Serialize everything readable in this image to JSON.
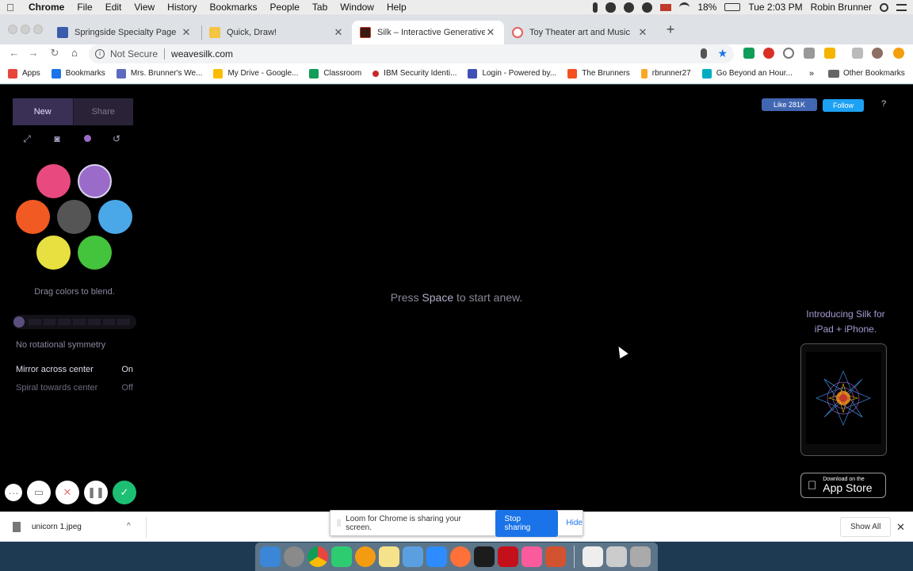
{
  "menubar": {
    "items": [
      "Chrome",
      "File",
      "Edit",
      "View",
      "History",
      "Bookmarks",
      "People",
      "Tab",
      "Window",
      "Help"
    ],
    "battery": "18%",
    "clock": "Tue 2:03 PM",
    "user": "Robin Brunner"
  },
  "tabs": [
    {
      "title": "Springside Specialty Page",
      "favicon_color": "#3b5bab"
    },
    {
      "title": "Quick, Draw!",
      "favicon_color": "#f4c542"
    },
    {
      "title": "Silk – Interactive Generative Art",
      "favicon_color": "#3a1a10"
    },
    {
      "title": "Toy Theater art and Music",
      "favicon_color": "#e46060"
    }
  ],
  "omnibox": {
    "security": "Not Secure",
    "url": "weavesilk.com"
  },
  "bookmarks": {
    "items": [
      {
        "label": "Apps",
        "color": "#e8453c"
      },
      {
        "label": "Bookmarks",
        "color": "#1a73e8"
      },
      {
        "label": "Mrs. Brunner's We...",
        "color": "#5c6bc0"
      },
      {
        "label": "My Drive - Google...",
        "color": "#fbbc04"
      },
      {
        "label": "Classroom",
        "color": "#0f9d58"
      },
      {
        "label": "IBM Security Identi...",
        "color": "#c62828"
      },
      {
        "label": "Login - Powered by...",
        "color": "#3f51b5"
      },
      {
        "label": "The Brunners",
        "color": "#f4511e"
      },
      {
        "label": "rbrunner27",
        "color": "#f9a825"
      },
      {
        "label": "Go Beyond an Hour...",
        "color": "#00acc1"
      }
    ],
    "more": "»",
    "other": "Other Bookmarks"
  },
  "silk": {
    "new_label": "New",
    "share_label": "Share",
    "drag_hint": "Drag colors to blend.",
    "symmetry_label": "No rotational symmetry",
    "mirror_label": "Mirror across center",
    "mirror_value": "On",
    "spiral_label": "Spiral towards center",
    "spiral_value": "Off",
    "press_space_pre": "Press ",
    "press_space_key": "Space",
    "press_space_post": " to start anew.",
    "fb_like": "Like 281K",
    "tw_follow": "Follow",
    "help": "?",
    "intro_line1": "Introducing Silk for",
    "intro_line2": "iPad + iPhone.",
    "appstore_small": "Download on the",
    "appstore_big": "App Store",
    "swatches": [
      "#e84a7f",
      "#9b6bc9",
      "#f15a22",
      "#555555",
      "#4aa8e8",
      "#e8e040",
      "#44c43c"
    ],
    "selected_swatch": 1
  },
  "loom_banner": {
    "text": "Loom for Chrome is sharing your screen.",
    "stop": "Stop sharing",
    "hide": "Hide"
  },
  "download_shelf": {
    "filename": "unicorn 1.jpeg",
    "show_all": "Show All"
  },
  "dock_colors": [
    "#3b86d6",
    "#8a8a8a",
    "#e8453c",
    "#2ecc71",
    "#f39c12",
    "#f5e28a",
    "#5aa0e0",
    "#2d8cff",
    "#ff7139",
    "#1c1c1c",
    "#c4101b",
    "#fb5b9c",
    "#d35230",
    "#eeeeee",
    "#cccccc",
    "#aaaaaa"
  ]
}
